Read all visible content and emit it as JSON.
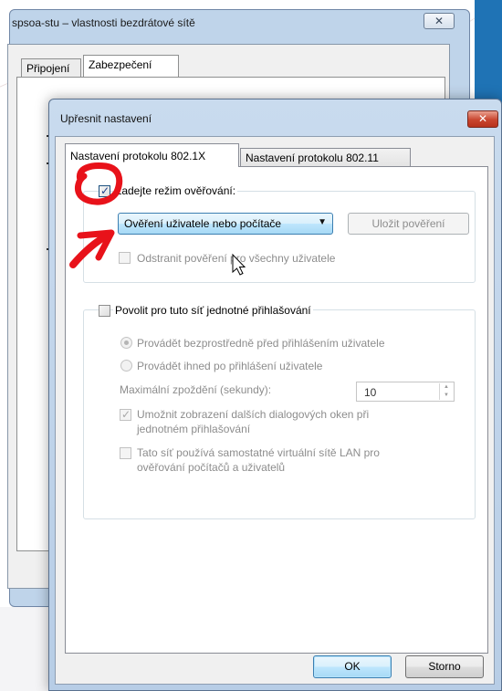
{
  "back_window": {
    "title": "spsoa-stu – vlastnosti bezdrátové sítě",
    "close_glyph": "✕",
    "tabs": [
      {
        "label": "Připojení"
      },
      {
        "label": "Zabezpečení"
      }
    ]
  },
  "dialog": {
    "title": "Upřesnit nastavení",
    "close_glyph": "✕",
    "tabs": [
      {
        "label": "Nastavení protokolu 802.1X"
      },
      {
        "label": "Nastavení protokolu 802.11"
      }
    ],
    "auth_mode": {
      "label": "Zadejte režim ověřování:",
      "checked": true,
      "dropdown_value": "Ověření uživatele nebo počítače",
      "save_credentials_label": "Uložit pověření",
      "remove_credentials_label": "Odstranit pověření pro všechny uživatele"
    },
    "sso": {
      "label": "Povolit pro tuto síť jednotné přihlašování",
      "checked": false,
      "option_before": "Provádět bezprostředně před přihlášením uživatele",
      "option_after": "Provádět ihned po přihlášení uživatele",
      "delay_label": "Maximální zpoždění (sekundy):",
      "delay_value": "10",
      "allow_dialogs_line1": "Umožnit zobrazení dalších dialogových oken při",
      "allow_dialogs_line2": "jednotném přihlašování",
      "vlan_line1": "Tato síť používá samostatné virtuální sítě LAN pro",
      "vlan_line2": "ověřování počítačů a uživatelů"
    },
    "buttons": {
      "ok": "OK",
      "cancel": "Storno"
    }
  },
  "colors": {
    "annotation": "#e8121a",
    "dialog_frame": "#b7cde6",
    "close_button": "#c8452e"
  }
}
